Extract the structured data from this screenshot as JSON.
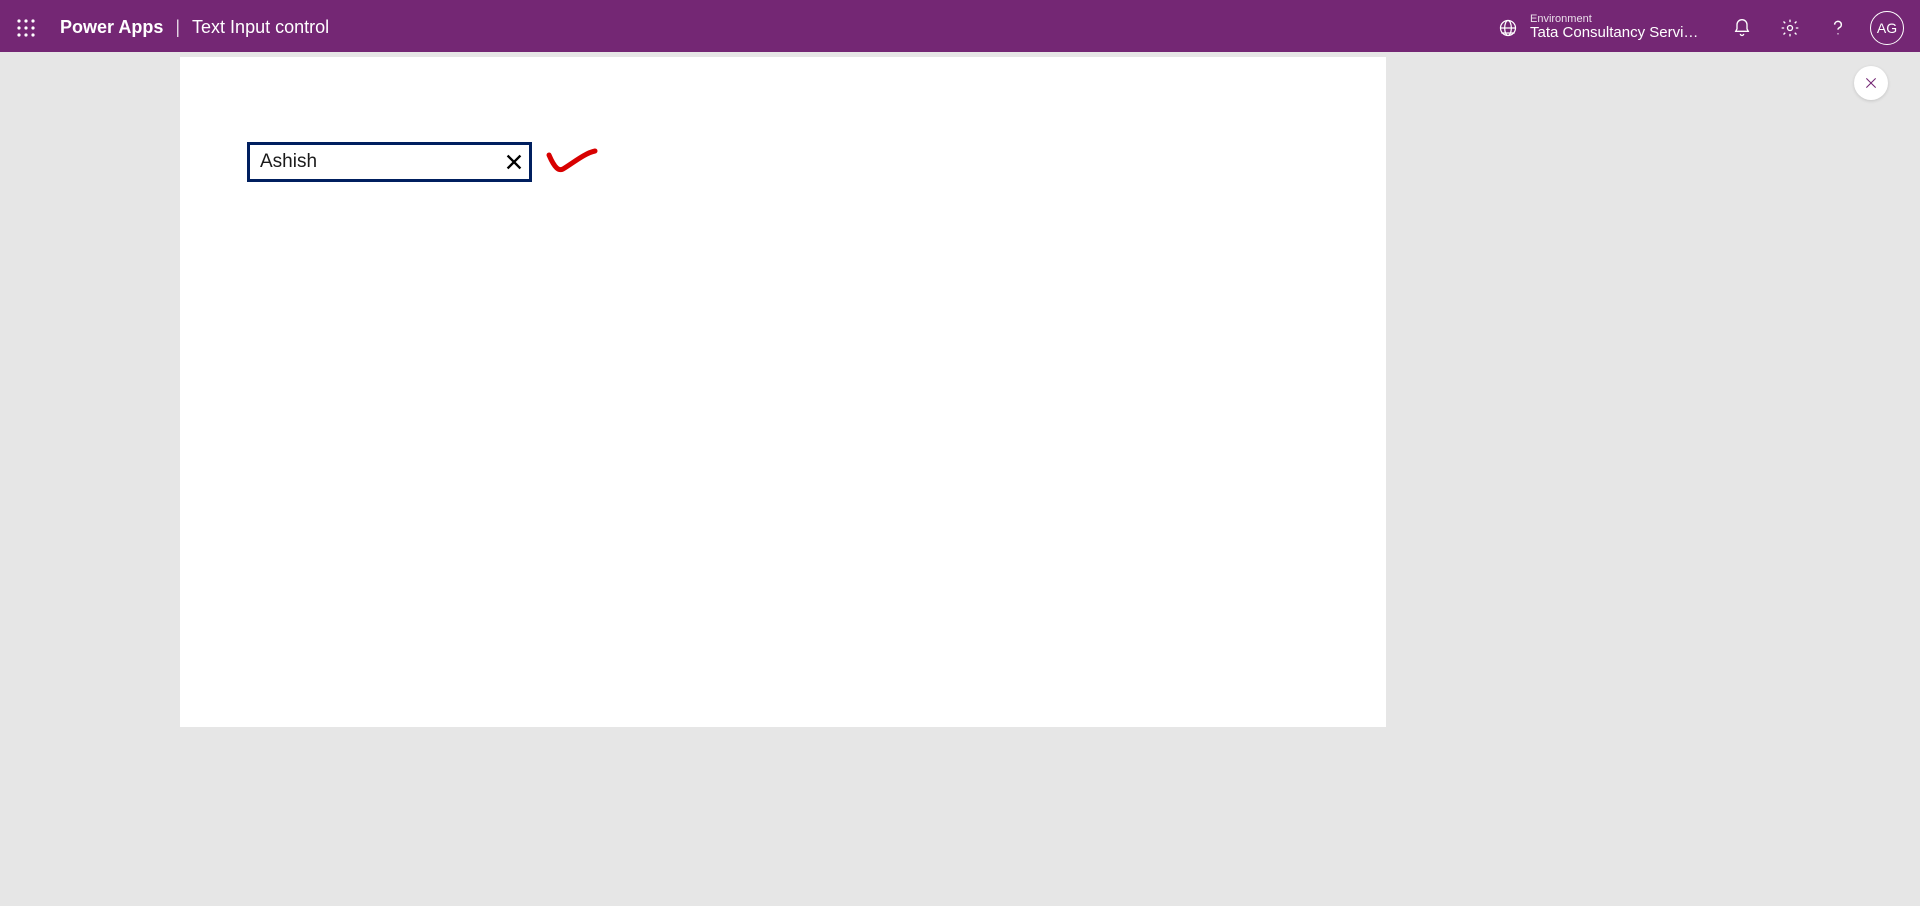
{
  "header": {
    "app_name": "Power Apps",
    "page_title": "Text Input control",
    "environment_label": "Environment",
    "environment_name": "Tata Consultancy Servic...",
    "user_initials": "AG"
  },
  "canvas": {
    "text_input_value": "Ashish"
  }
}
